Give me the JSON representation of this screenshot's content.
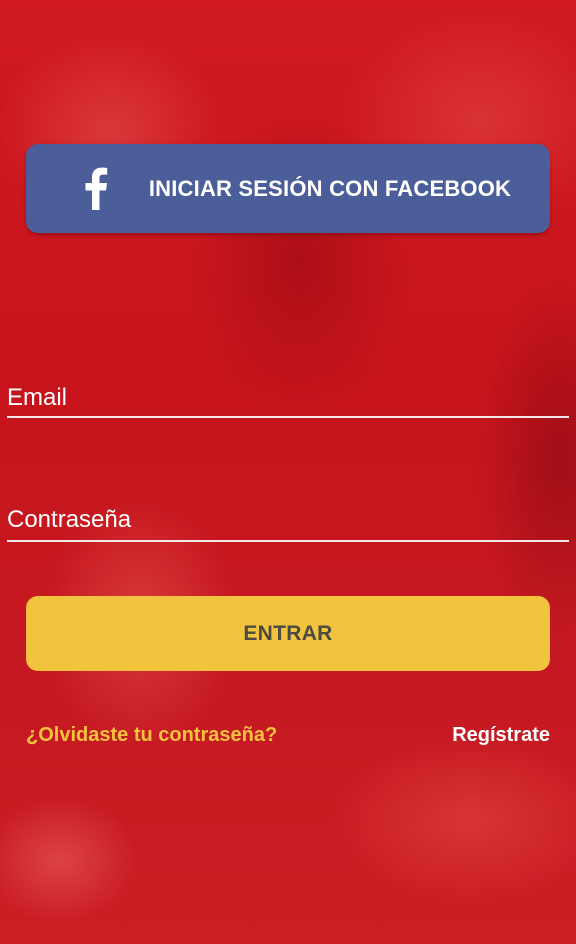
{
  "facebook_login": {
    "label": "INICIAR SESIÓN CON FACEBOOK",
    "icon": "facebook-icon",
    "color": "#4b5e9a"
  },
  "form": {
    "email_placeholder": "Email",
    "password_placeholder": "Contraseña"
  },
  "actions": {
    "enter_label": "ENTRAR",
    "enter_color": "#f2c43d",
    "forgot_password_label": "¿Olvidaste tu contraseña?",
    "forgot_password_color": "#f3c33c",
    "register_label": "Regístrate"
  },
  "theme": {
    "background_color": "#c8151c",
    "text_color": "#ffffff"
  }
}
